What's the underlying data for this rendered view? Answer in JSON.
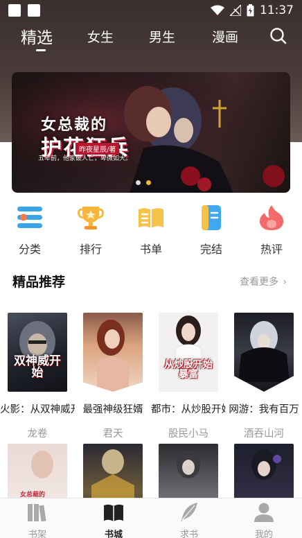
{
  "status": {
    "time": "11:37"
  },
  "nav": {
    "tabs": [
      "精选",
      "女生",
      "男生",
      "漫画"
    ],
    "active": 0
  },
  "banner": {
    "title_line1": "女总裁的",
    "title_line2": "护花狂兵",
    "author": "昨夜星辰/著",
    "tagline": "五年前，他家破人亡，卑微如犬。",
    "slides": 2,
    "active_slide": 1
  },
  "quick": [
    {
      "label": "分类",
      "icon": "category-icon"
    },
    {
      "label": "排行",
      "icon": "trophy-icon"
    },
    {
      "label": "书单",
      "icon": "book-list-icon"
    },
    {
      "label": "完结",
      "icon": "finished-icon"
    },
    {
      "label": "热评",
      "icon": "hot-review-icon"
    }
  ],
  "section": {
    "title": "精品推荐",
    "more": "查看更多"
  },
  "books": [
    {
      "title": "火影：从双神威开始",
      "author": "龙卷",
      "cover_text": "双神威开始"
    },
    {
      "title": "最强神级狂婿",
      "author": "君天",
      "cover_text": ""
    },
    {
      "title": "都市：从炒股开始",
      "author": "股民小马",
      "cover_text": "从炒股开始暴富"
    },
    {
      "title": "网游：我有百万",
      "author": "酒吞山河",
      "cover_text": ""
    }
  ],
  "books_row2_cover_text": [
    "女总裁的",
    "",
    "",
    ""
  ],
  "tabbar": [
    {
      "label": "书架",
      "icon": "bookshelf-icon"
    },
    {
      "label": "书城",
      "icon": "bookstore-icon"
    },
    {
      "label": "求书",
      "icon": "request-book-icon"
    },
    {
      "label": "我的",
      "icon": "profile-icon"
    }
  ],
  "colors": {
    "accent_dot": "#f0b93a",
    "header_bg": "#3a2f2f"
  }
}
